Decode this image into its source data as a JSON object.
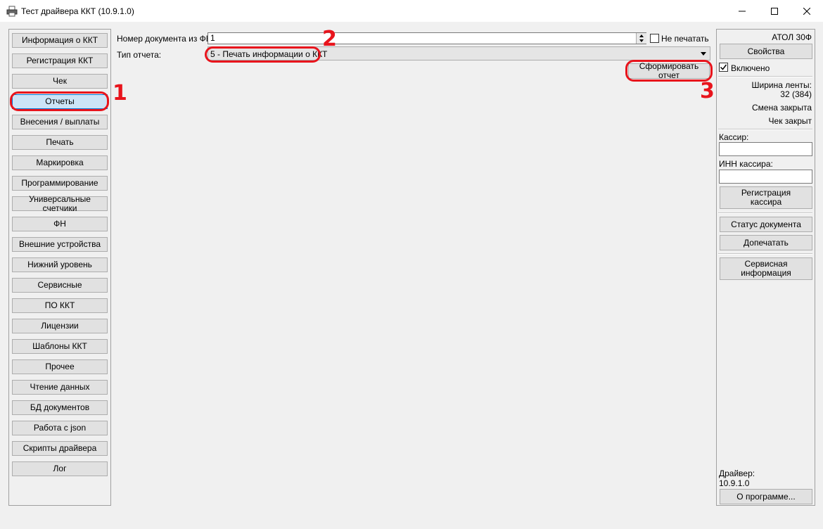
{
  "window": {
    "title": "Тест драйвера ККТ (10.9.1.0)"
  },
  "sidebar": {
    "items": [
      {
        "label": "Информация о ККТ"
      },
      {
        "label": "Регистрация ККТ"
      },
      {
        "label": "Чек"
      },
      {
        "label": "Отчеты",
        "selected": true
      },
      {
        "label": "Внесения / выплаты"
      },
      {
        "label": "Печать"
      },
      {
        "label": "Маркировка"
      },
      {
        "label": "Программирование"
      },
      {
        "label": "Универсальные счетчики"
      },
      {
        "label": "ФН"
      },
      {
        "label": "Внешние устройства"
      },
      {
        "label": "Нижний уровень"
      },
      {
        "label": "Сервисные"
      },
      {
        "label": "ПО ККТ"
      },
      {
        "label": "Лицензии"
      },
      {
        "label": "Шаблоны ККТ"
      },
      {
        "label": "Прочее"
      },
      {
        "label": "Чтение данных"
      },
      {
        "label": "БД документов"
      },
      {
        "label": "Работа с json"
      },
      {
        "label": "Скрипты драйвера"
      },
      {
        "label": "Лог"
      }
    ]
  },
  "main": {
    "doc_number_label": "Номер документа из ФН:",
    "doc_number_value": "1",
    "no_print_label": "Не печатать",
    "no_print_checked": false,
    "report_type_label": "Тип отчета:",
    "report_type_value": "5 - Печать информации о ККТ",
    "generate_button": "Сформировать отчет"
  },
  "right_panel": {
    "device_name": "АТОЛ 30Ф",
    "properties_button": "Свойства",
    "enabled_label": "Включено",
    "enabled_checked": true,
    "tape_width_label": "Ширина ленты:",
    "tape_width_value": "32 (384)",
    "shift_status": "Смена закрыта",
    "receipt_status": "Чек закрыт",
    "cashier_label": "Кассир:",
    "cashier_value": "",
    "cashier_inn_label": "ИНН кассира:",
    "cashier_inn_value": "",
    "register_cashier_line1": "Регистрация",
    "register_cashier_line2": "кассира",
    "doc_status_button": "Статус документа",
    "reprint_button": "Допечатать",
    "service_info_line1": "Сервисная",
    "service_info_line2": "информация",
    "driver_label": "Драйвер:",
    "driver_version": "10.9.1.0",
    "about_button": "О программе..."
  },
  "annotations": {
    "marker_1": "1",
    "marker_2": "2",
    "marker_3": "3",
    "color": "#e8141c"
  },
  "colors": {
    "selected_tab": "#cce4f7",
    "selected_border": "#0078d7"
  }
}
